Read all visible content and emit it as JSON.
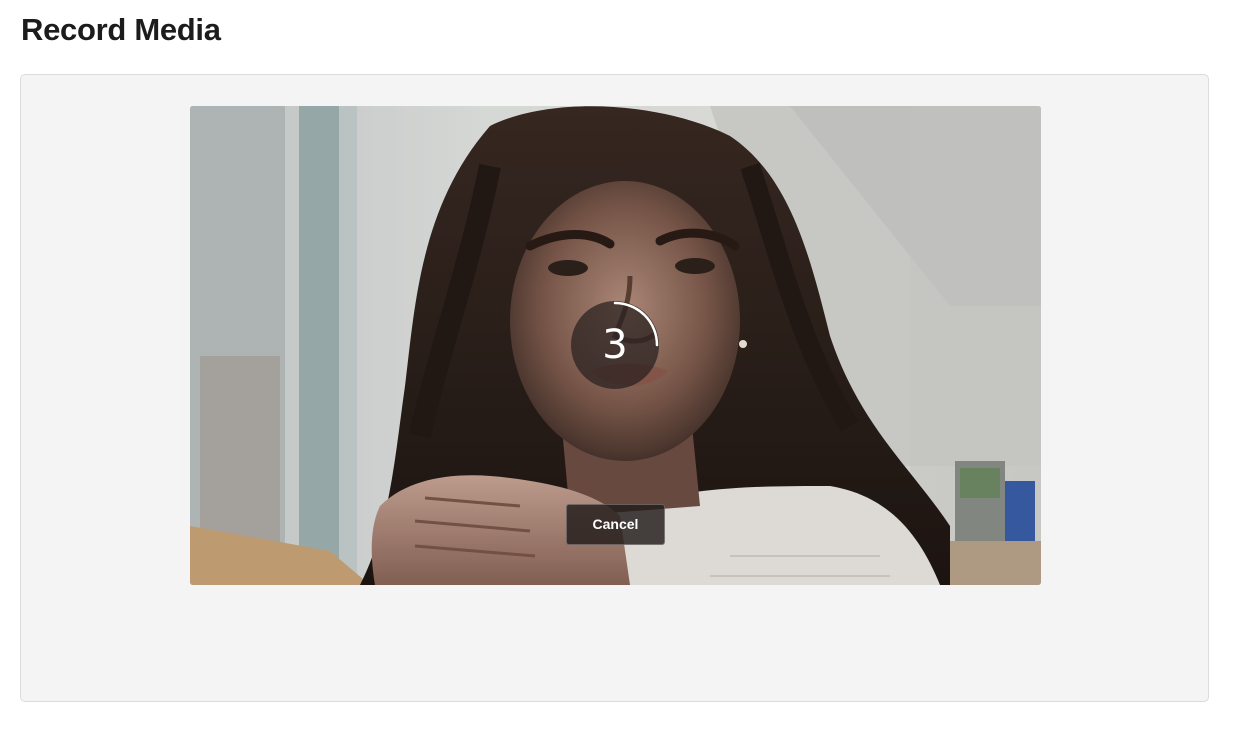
{
  "page": {
    "title": "Record Media"
  },
  "recorder": {
    "countdown": {
      "value": "3",
      "progress_fraction": 0.25
    },
    "cancel_label": "Cancel"
  },
  "colors": {
    "panel_background": "#f4f4f4",
    "panel_border": "#dcdcdc",
    "title_text": "#1c1c1c",
    "overlay_text": "#ffffff"
  }
}
